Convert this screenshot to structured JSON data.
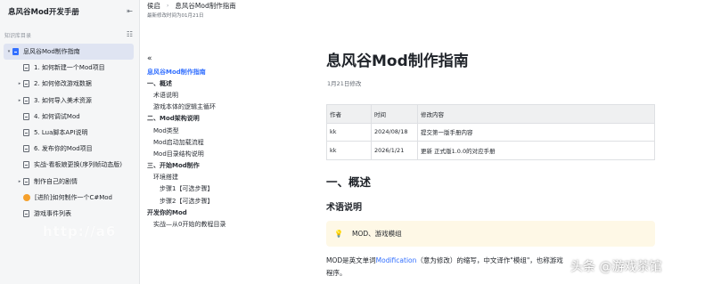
{
  "sidebar": {
    "title": "息风谷Mod开发手册",
    "section_label": "知识库目录",
    "items": [
      {
        "label": "息风谷Mod制作指南",
        "level": 0,
        "arrow": "▾",
        "active": true
      },
      {
        "label": "1. 如何新建一个Mod项目",
        "level": 1,
        "arrow": ""
      },
      {
        "label": "2. 如何修改游戏数据",
        "level": 1,
        "arrow": "▸"
      },
      {
        "label": "3. 如何导入美术资源",
        "level": 1,
        "arrow": "▸"
      },
      {
        "label": "4. 如何调试Mod",
        "level": 1,
        "arrow": ""
      },
      {
        "label": "5. Lua脚本API说明",
        "level": 1,
        "arrow": ""
      },
      {
        "label": "6. 发布你的Mod项目",
        "level": 1,
        "arrow": ""
      },
      {
        "label": "实战-看板娘更换(序列帧动态版)",
        "level": 1,
        "arrow": ""
      },
      {
        "label": "制作自己的剧情",
        "level": 1,
        "arrow": "▸"
      },
      {
        "label": "[进阶]如何制作一个C#Mod",
        "level": 1,
        "arrow": ""
      },
      {
        "label": "游戏事件列表",
        "level": 1,
        "arrow": ""
      }
    ]
  },
  "topbar": {
    "breadcrumbs": [
      "侯启",
      "息风谷Mod制作指南"
    ],
    "modified": "最新修改时间为01月21日"
  },
  "outline": {
    "items": [
      {
        "label": "息风谷Mod制作指南",
        "kind": "title"
      },
      {
        "label": "一、概述",
        "kind": "h1"
      },
      {
        "label": "术语说明",
        "kind": "h2"
      },
      {
        "label": "游戏本体的逻辑主循环",
        "kind": "h2"
      },
      {
        "label": "二、Mod架构说明",
        "kind": "h1"
      },
      {
        "label": "Mod类型",
        "kind": "h2"
      },
      {
        "label": "Mod启动加载流程",
        "kind": "h2"
      },
      {
        "label": "Mod目录结构说明",
        "kind": "h2"
      },
      {
        "label": "三、开始Mod制作",
        "kind": "h1"
      },
      {
        "label": "环境搭建",
        "kind": "h2"
      },
      {
        "label": "步骤1【可选步骤】",
        "kind": "h3"
      },
      {
        "label": "步骤2【可选步骤】",
        "kind": "h3"
      },
      {
        "label": "开发你的Mod",
        "kind": "h1"
      },
      {
        "label": "实战—从0开始的教程目录",
        "kind": "h2"
      }
    ]
  },
  "document": {
    "title": "息风谷Mod制作指南",
    "date": "1月21日修改",
    "table": {
      "headers": [
        "作者",
        "时间",
        "修改内容"
      ],
      "rows": [
        [
          "kk",
          "2024/08/18",
          "提交第一版手册内容"
        ],
        [
          "kk",
          "2026/1/21",
          "更新 正式版1.0.0的对应手册"
        ]
      ]
    },
    "h1_overview": "一、概述",
    "h2_terms": "术语说明",
    "callout": "MOD、游戏模组",
    "para_pre": "MOD是英文单词",
    "para_link": "Modification",
    "para_post": "（意为修改）的缩写，中文译作\"模组\"，也称游戏",
    "para_line2": "程序。"
  },
  "overlay": {
    "watermark": "http://a6",
    "brand": "头条 @游戏茶馆"
  },
  "icons": {
    "collapse_sidebar": "collapse-left-icon",
    "toc_toggle": "list-icon",
    "outline_collapse": "double-chevron-left-icon",
    "callout": "lightbulb-icon"
  },
  "colors": {
    "accent": "#3370ff",
    "active_bg": "#dfe4f2",
    "callout_bg": "#fef8e6"
  }
}
